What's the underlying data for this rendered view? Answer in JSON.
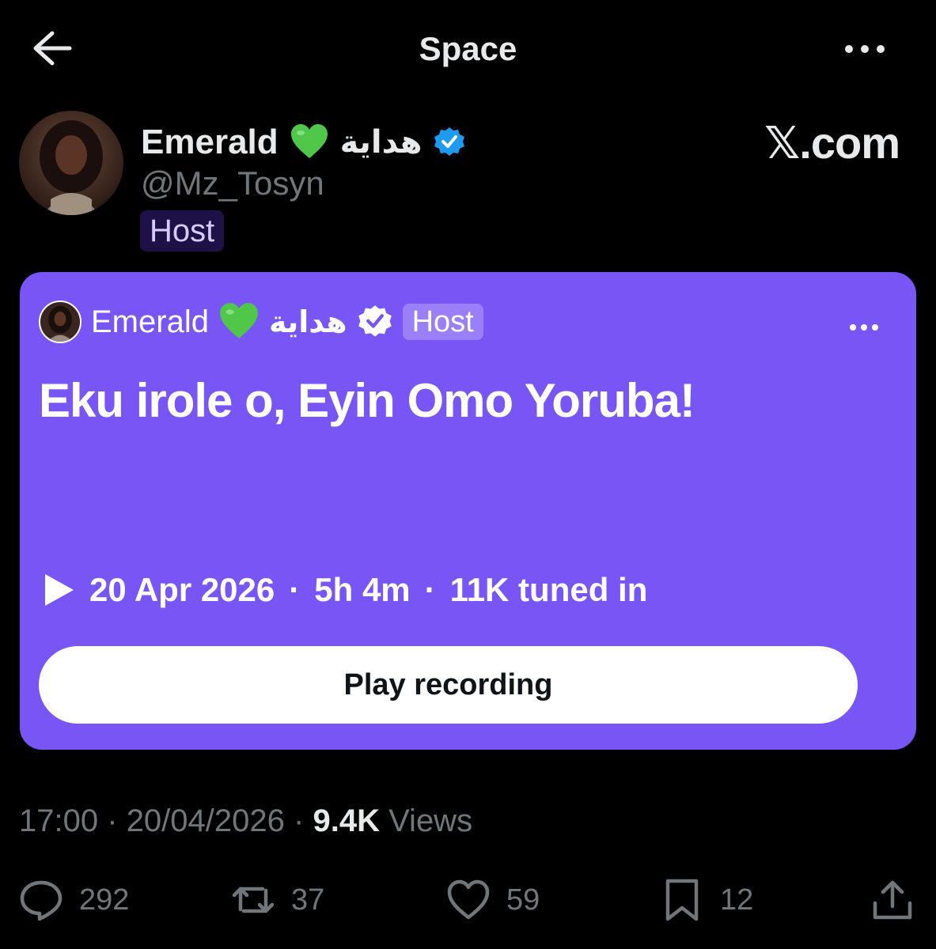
{
  "header": {
    "title": "Space",
    "back_icon": "arrow-left-icon",
    "more_icon": "more-horizontal-icon"
  },
  "host": {
    "name": "Emerald",
    "emoji": "green-heart",
    "arabic_name": "هداية",
    "verified": true,
    "handle": "@Mz_Tosyn",
    "role_badge": "Host",
    "watermark": "𝕏.com"
  },
  "space_card": {
    "bg_color": "#7856f5",
    "host_name": "Emerald",
    "host_arabic_name": "هداية",
    "host_badge": "Host",
    "title": "Eku irole o, Eyin Omo Yoruba!",
    "date": "20 Apr 2026",
    "duration": "5h 4m",
    "listeners": "11K tuned in",
    "separator": "·",
    "play_button_label": "Play recording"
  },
  "post_meta": {
    "time": "17:00",
    "date": "20/04/2026",
    "separator": "·",
    "views_count": "9.4K",
    "views_label": "Views"
  },
  "actions": {
    "replies": "292",
    "reposts": "37",
    "likes": "59",
    "bookmarks": "12"
  },
  "colors": {
    "background": "#000000",
    "card": "#7856f5",
    "verified_blue": "#1d9bf0",
    "muted_text": "#71767b"
  }
}
